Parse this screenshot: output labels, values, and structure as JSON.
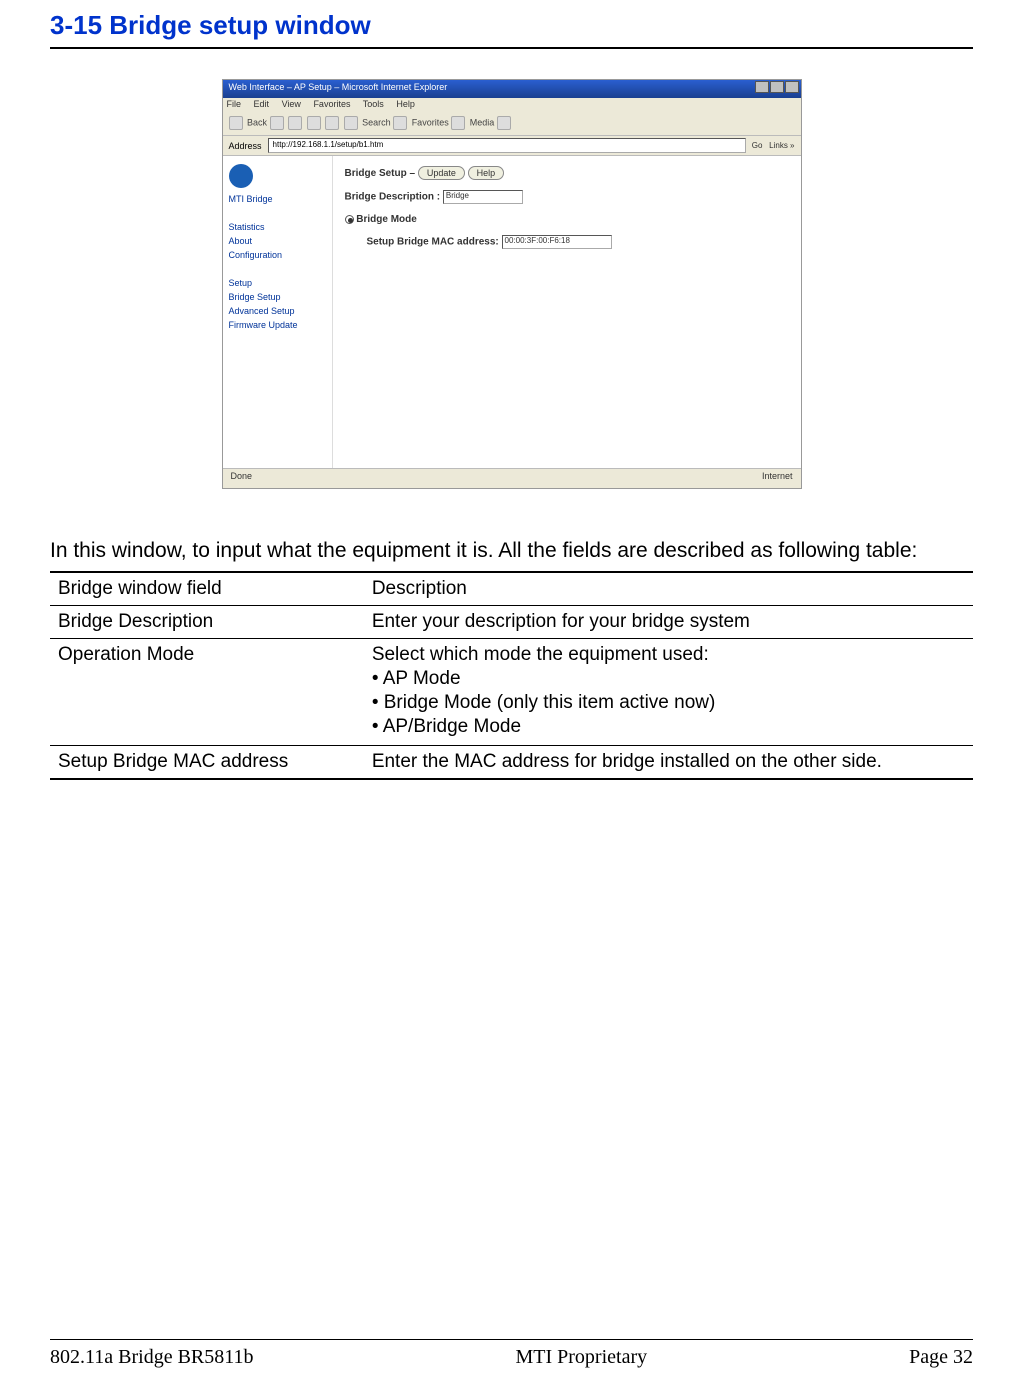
{
  "heading": "3-15 Bridge setup window",
  "screenshot": {
    "window_title": "Web Interface – AP Setup – Microsoft Internet Explorer",
    "menu": {
      "file": "File",
      "edit": "Edit",
      "view": "View",
      "favorites": "Favorites",
      "tools": "Tools",
      "help": "Help"
    },
    "toolbar": {
      "back": "Back",
      "search": "Search",
      "favorites": "Favorites",
      "media": "Media"
    },
    "address_label": "Address",
    "address_value": "http://192.168.1.1/setup/b1.htm",
    "go": "Go",
    "links": "Links",
    "sidebar": {
      "brand": "MTI Bridge",
      "statistics": "Statistics",
      "about": "About",
      "configuration": "Configuration",
      "setup": "Setup",
      "bridge_setup": "Bridge Setup",
      "advanced_setup": "Advanced Setup",
      "firmware_update": "Firmware Update"
    },
    "main": {
      "title_prefix": "Bridge Setup –",
      "update_btn": "Update",
      "help_btn": "Help",
      "desc_label": "Bridge Description :",
      "desc_value": "Bridge",
      "mode_label": "Bridge Mode",
      "mac_label": "Setup Bridge MAC address:",
      "mac_value": "00:00:3F:00:F6:18"
    },
    "status": {
      "done": "Done",
      "zone": "Internet"
    }
  },
  "intro": "In this window, to input what the equipment it is. All the fields are described as following table:",
  "table": {
    "header": {
      "field": "Bridge window field",
      "desc": "Description"
    },
    "rows": [
      {
        "field": "Bridge Description",
        "desc": "Enter your description for your bridge system"
      },
      {
        "field": "Operation Mode",
        "desc_intro": "Select which mode the equipment used:",
        "bullets": [
          "AP Mode",
          "Bridge Mode (only this item active now)",
          "AP/Bridge Mode"
        ]
      },
      {
        "field": "Setup Bridge MAC address",
        "desc": "Enter the MAC address for bridge installed on the other side."
      }
    ]
  },
  "footer": {
    "left": "802.11a Bridge  BR5811b",
    "center": "MTI Proprietary",
    "right": "Page 32"
  }
}
